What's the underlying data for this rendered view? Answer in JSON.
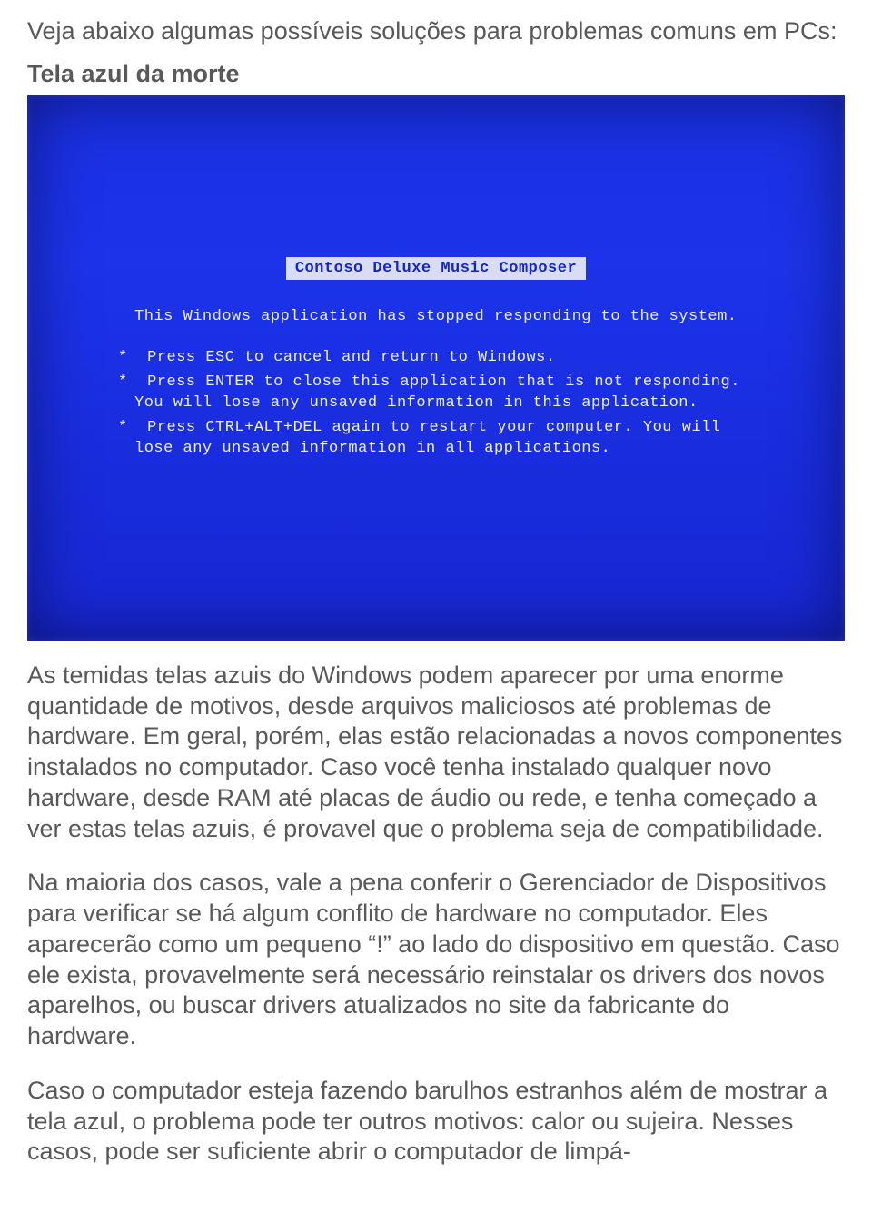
{
  "intro": "Veja abaixo algumas possíveis soluções para problemas comuns em PCs:",
  "heading": "Tela azul da morte",
  "bsod": {
    "title": "Contoso Deluxe Music Composer",
    "intro_line": "This Windows application has stopped responding to the system.",
    "bullets": [
      "Press ESC to cancel and return to Windows.",
      "Press ENTER to close this application that is not responding. You will lose any unsaved information in this application.",
      "Press CTRL+ALT+DEL again to restart your computer. You will lose any unsaved information in all applications."
    ]
  },
  "paragraphs": [
    "As temidas telas azuis do Windows podem aparecer por uma enorme quantidade de motivos, desde arquivos maliciosos até problemas de hardware. Em geral, porém, elas estão relacionadas a novos componentes instalados no computador. Caso você tenha instalado qualquer novo hardware, desde RAM até placas de áudio ou rede, e tenha começado a ver estas telas azuis, é provavel que o problema seja de compatibilidade.",
    "Na maioria dos casos, vale a pena conferir o Gerenciador de Dispositivos para verificar se há algum conflito de hardware no computador. Eles aparecerão como um pequeno “!” ao lado do dispositivo em questão. Caso ele exista, provavelmente será necessário reinstalar os drivers dos novos aparelhos, ou buscar drivers atualizados no site da fabricante do hardware.",
    "Caso o computador esteja fazendo barulhos estranhos além de mostrar a tela azul, o problema pode ter outros motivos: calor ou sujeira. Nesses casos, pode ser suficiente abrir o computador de limpá-"
  ]
}
